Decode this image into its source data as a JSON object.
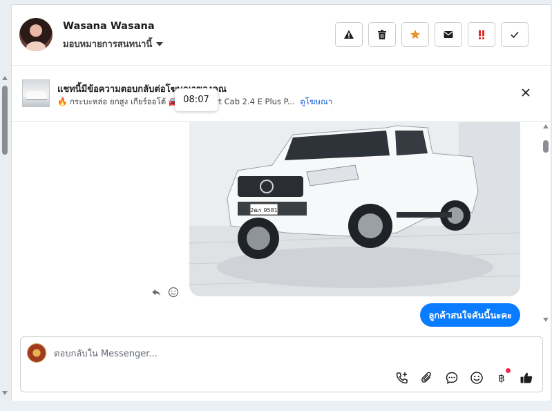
{
  "header": {
    "contact_name": "Wasana Wasana",
    "assign_label": "มอบหมายการสนทนานี้",
    "actions": [
      {
        "name": "report-spam-button",
        "icon": "warning-icon"
      },
      {
        "name": "delete-button",
        "icon": "trash-icon"
      },
      {
        "name": "star-button",
        "icon": "star-icon"
      },
      {
        "name": "mark-unread-button",
        "icon": "envelope-icon"
      },
      {
        "name": "follow-up-button",
        "icon": "double-exclamation-icon"
      },
      {
        "name": "mark-done-button",
        "icon": "check-icon"
      }
    ]
  },
  "ad_banner": {
    "title": "แชทนี้มีข้อความตอบกลับต่อโฆษณาของคุณ",
    "subtitle": "🔥 กระบะหล่อ ยกสูง เกียร์ออโต้ 🚘 Hi",
    "subtitle_tail": "art Cab 2.4 E Plus P...",
    "link_label": "ดูโฆษณา"
  },
  "tooltip": {
    "time": "08:07"
  },
  "chat": {
    "image_alt": "white pickup truck photo",
    "outgoing_message": "ลูกค้าสนใจคันนี้นะคะ",
    "license_plate": "2ฒร 9581"
  },
  "composer": {
    "placeholder": "ตอบกลับใน Messenger...",
    "tools": [
      "call-add-icon",
      "paperclip-icon",
      "chat-bubble-icon",
      "emoji-icon",
      "baht-icon",
      "thumbs-up-icon"
    ]
  },
  "colors": {
    "accent": "#0a7cff",
    "star": "#f0932b",
    "urgent": "#e02d2d",
    "link": "#1a66d6",
    "notification_dot": "#f02849"
  }
}
